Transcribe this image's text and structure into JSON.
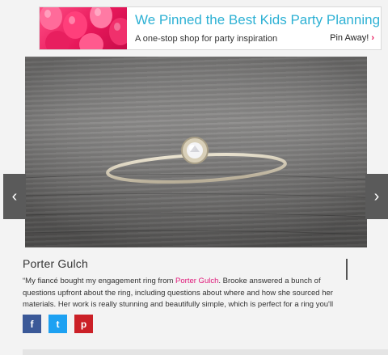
{
  "ad": {
    "title": "We Pinned the Best Kids Party Planning Tips",
    "subtitle": "A one-stop shop for party inspiration",
    "cta": "Pin Away!",
    "cta_chevron": "›",
    "accent_color": "#2eb1d4",
    "brand_color": "#e8185b"
  },
  "slider": {
    "image_subject": "diamond solitaire ring on wood",
    "prev_icon": "‹",
    "next_icon": "›"
  },
  "caption": {
    "title": "Porter Gulch",
    "text_before": "“My fiancé bought my engagement ring from ",
    "link": "Porter Gulch",
    "text_after": ". Brooke answered a bunch of questions upfront about the ring, including questions about where and how she sourced her materials. Her work is really stunning and beautifully simple, which is perfect for a ring you'll be wearing for the rest of your life. My partner thinks my engagement ring looks like it was made just for me.",
    "link_color": "#e0197a"
  },
  "share": {
    "facebook": "f",
    "twitter": "t",
    "pinterest": "p"
  }
}
